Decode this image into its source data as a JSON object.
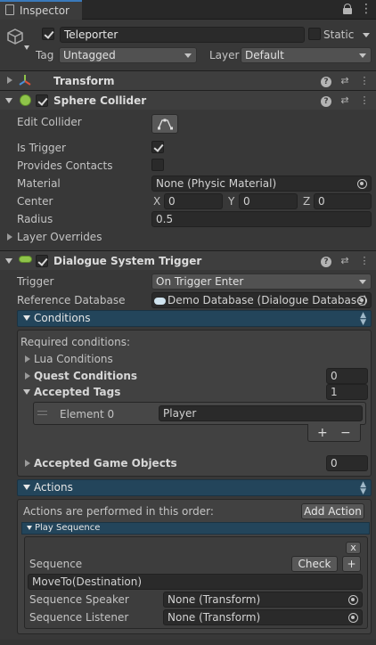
{
  "tab": {
    "title": "Inspector",
    "lock_icon": "lock-icon",
    "menu_icon": "kebab-menu-icon"
  },
  "gameobject": {
    "name": "Teleporter",
    "active": true,
    "static_label": "Static",
    "static": false,
    "tag_label": "Tag",
    "tag_value": "Untagged",
    "layer_label": "Layer",
    "layer_value": "Default"
  },
  "transform": {
    "title": "Transform"
  },
  "sphere_collider": {
    "title": "Sphere Collider",
    "enabled": true,
    "edit_collider_label": "Edit Collider",
    "is_trigger_label": "Is Trigger",
    "is_trigger": true,
    "provides_contacts_label": "Provides Contacts",
    "provides_contacts": false,
    "material_label": "Material",
    "material_value": "None (Physic Material)",
    "center_label": "Center",
    "center": {
      "x_label": "X",
      "x": "0",
      "y_label": "Y",
      "y": "0",
      "z_label": "Z",
      "z": "0"
    },
    "radius_label": "Radius",
    "radius": "0.5",
    "layer_overrides_label": "Layer Overrides"
  },
  "dialogue_trigger": {
    "title": "Dialogue System Trigger",
    "enabled": true,
    "trigger_label": "Trigger",
    "trigger_value": "On Trigger Enter",
    "reference_db_label": "Reference Database",
    "reference_db_value": "Demo Database (Dialogue Database)",
    "conditions": {
      "title": "Conditions",
      "required_label": "Required conditions:",
      "lua_label": "Lua Conditions",
      "quest_label": "Quest Conditions",
      "quest_count": "0",
      "tags_label": "Accepted Tags",
      "tags_count": "1",
      "tag_elements": [
        {
          "label": "Element 0",
          "value": "Player"
        }
      ],
      "add_label": "+",
      "remove_label": "−",
      "objects_label": "Accepted Game Objects",
      "objects_count": "0"
    },
    "actions": {
      "title": "Actions",
      "order_label": "Actions are performed in this order:",
      "add_action_label": "Add Action",
      "play_sequence_title": "Play Sequence",
      "close_label": "x",
      "sequence_label": "Sequence",
      "check_label": "Check",
      "plus_label": "+",
      "sequence_value": "MoveTo(Destination)",
      "speaker_label": "Sequence Speaker",
      "speaker_value": "None (Transform)",
      "listener_label": "Sequence Listener",
      "listener_value": "None (Transform)"
    }
  },
  "colors": {
    "panel": "#383838",
    "header": "#3e3e3e",
    "section_bar": "#23455b",
    "field": "#2a2a2a"
  }
}
